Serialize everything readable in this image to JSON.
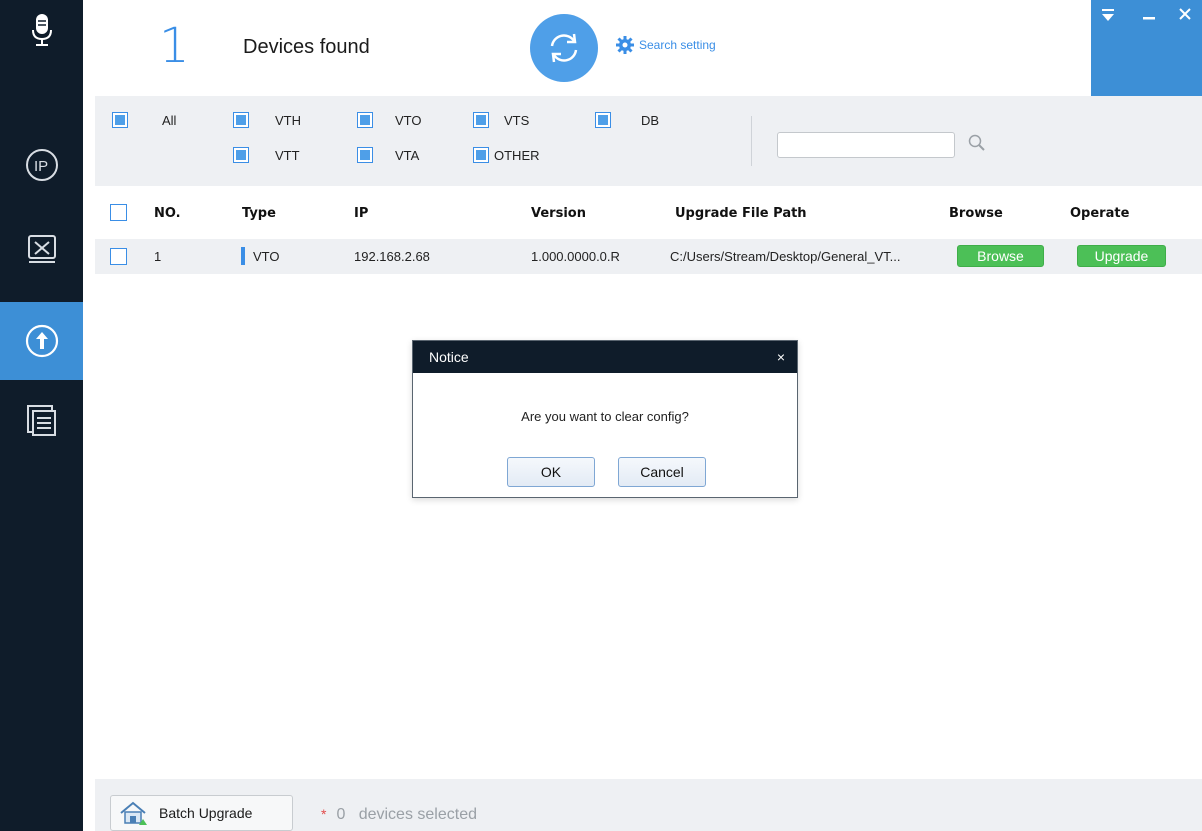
{
  "header": {
    "device_count": "1",
    "devices_found_label": "Devices found",
    "search_setting_label": "Search setting"
  },
  "sidebar": {
    "items": [
      {
        "name": "microphone-icon"
      },
      {
        "name": "ip-search-icon"
      },
      {
        "name": "tools-icon"
      },
      {
        "name": "upgrade-icon",
        "active": true
      },
      {
        "name": "document-list-icon"
      }
    ]
  },
  "filters": {
    "all": "All",
    "vth": "VTH",
    "vto": "VTO",
    "vts": "VTS",
    "db": "DB",
    "vtt": "VTT",
    "vta": "VTA",
    "other": "OTHER",
    "search_value": ""
  },
  "table": {
    "columns": [
      "NO.",
      "Type",
      "IP",
      "Version",
      "Upgrade File Path",
      "Browse",
      "Operate"
    ],
    "rows": [
      {
        "no": "1",
        "type": "VTO",
        "ip": "192.168.2.68",
        "version": "1.000.0000.0.R",
        "path": "C:/Users/Stream/Desktop/General_VT...",
        "browse": "Browse",
        "operate": "Upgrade"
      }
    ]
  },
  "footer": {
    "batch_upgrade_label": "Batch Upgrade",
    "star": "*",
    "selected_count": "0",
    "selected_label": "devices selected"
  },
  "dialog": {
    "title": "Notice",
    "close": "×",
    "message": "Are you want to clear config?",
    "ok": "OK",
    "cancel": "Cancel"
  },
  "colors": {
    "sidebar_bg": "#0f1c2a",
    "accent_blue": "#3d8fd6",
    "green": "#4cc057"
  }
}
